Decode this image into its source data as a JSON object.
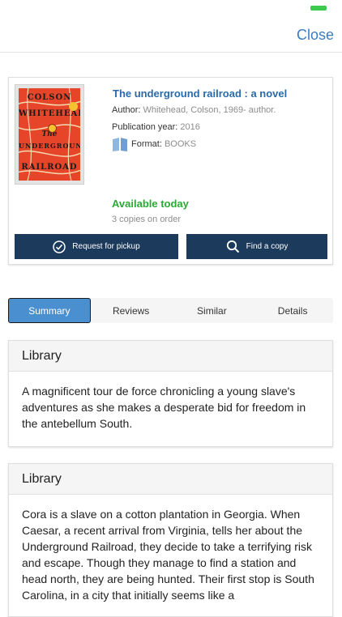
{
  "header": {
    "close_label": "Close",
    "battery_color": "#3cc94e"
  },
  "book": {
    "cover_words": [
      "COLSON",
      "WHITEHEAD",
      "The",
      "UNDERGROUND",
      "RAILROAD"
    ],
    "title": "The underground railroad : a novel",
    "author_label": "Author:",
    "author": "Whitehead, Colson, 1969- author.",
    "pub_label": "Publication year:",
    "pub_year": "2016",
    "format_icon": "book-icon",
    "format_label": "Format:",
    "format": "BOOKS",
    "availability": "Available today",
    "availability_color": "#2aaa34",
    "copies": "3 copies on order"
  },
  "actions": {
    "pickup_label": "Request for pickup",
    "pickup_icon": "check-circle-icon",
    "find_label": "Find a copy",
    "find_icon": "search-icon",
    "button_color": "#1c3a5c"
  },
  "tabs": [
    {
      "label": "Summary",
      "active": true
    },
    {
      "label": "Reviews",
      "active": false
    },
    {
      "label": "Similar",
      "active": false
    },
    {
      "label": "Details",
      "active": false
    }
  ],
  "panels": [
    {
      "heading": "Library",
      "text": "A magnificent tour de force chronicling a young slave's adventures as she makes a desperate bid for freedom in the antebellum South."
    },
    {
      "heading": "Library",
      "text": "Cora is a slave on a cotton plantation in Georgia. When Caesar, a recent arrival from Virginia, tells her about the Underground Railroad, they decide to take a terrifying risk and escape. Though they manage to find a station and head north, they are being hunted. Their first stop is South Carolina, in a city that initially seems like a"
    }
  ]
}
